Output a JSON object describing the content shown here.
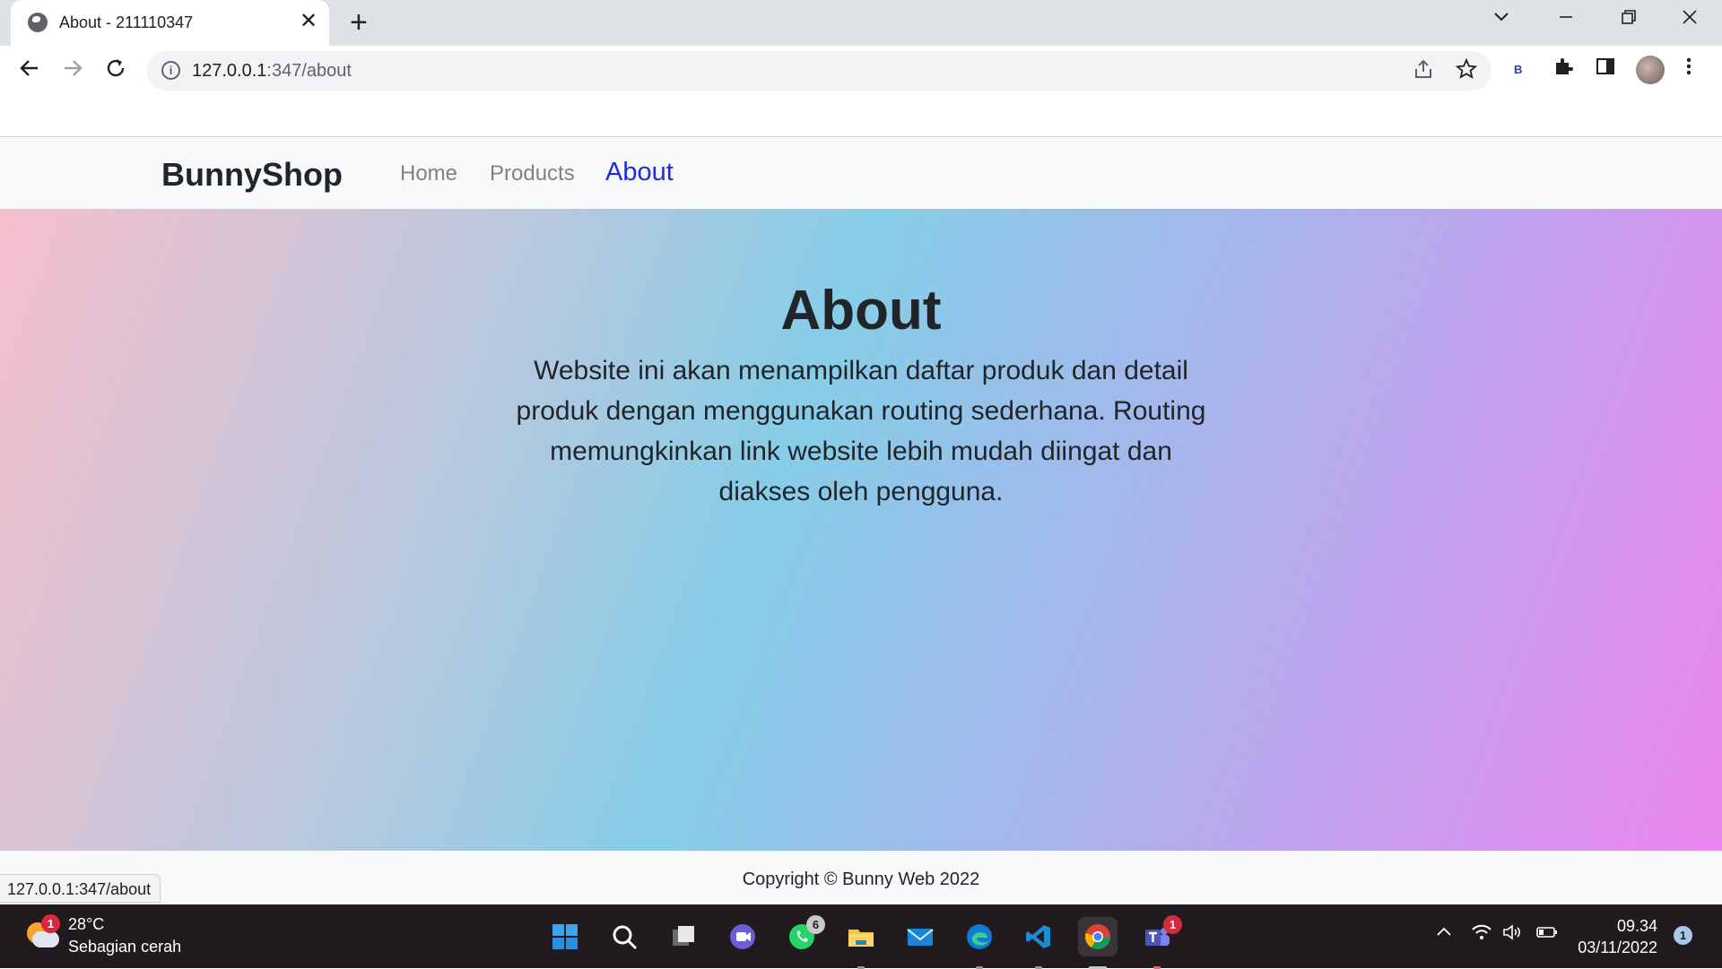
{
  "browser": {
    "tab_title": "About - 211110347",
    "close_glyph": "✕",
    "newtab_glyph": "+",
    "url_host": "127.0.0.1",
    "url_path": ":347/about",
    "profile_extension_letter": "B",
    "status_url": "127.0.0.1:347/about"
  },
  "site": {
    "brand": "BunnyShop",
    "nav": [
      {
        "label": "Home",
        "active": false
      },
      {
        "label": "Products",
        "active": false
      },
      {
        "label": "About",
        "active": true
      }
    ],
    "heading": "About",
    "description": "Website ini akan menampilkan daftar produk dan detail produk dengan menggunakan routing sederhana. Routing memungkinkan link website lebih mudah diingat dan diakses oleh pengguna.",
    "footer": "Copyright © Bunny Web 2022",
    "active_color": "#1d2bd8"
  },
  "taskbar": {
    "weather_badge": "1",
    "temperature": "28°C",
    "condition": "Sebagian cerah",
    "whatsapp_badge": "6",
    "teams_badge": "1",
    "time": "09.34",
    "date": "03/11/2022",
    "notification_count": "1",
    "apps": [
      "start-icon",
      "search-icon",
      "task-view-icon",
      "chat-icon",
      "whatsapp-icon",
      "file-explorer-icon",
      "mail-icon",
      "edge-icon",
      "vscode-icon",
      "chrome-icon",
      "teams-icon"
    ]
  }
}
